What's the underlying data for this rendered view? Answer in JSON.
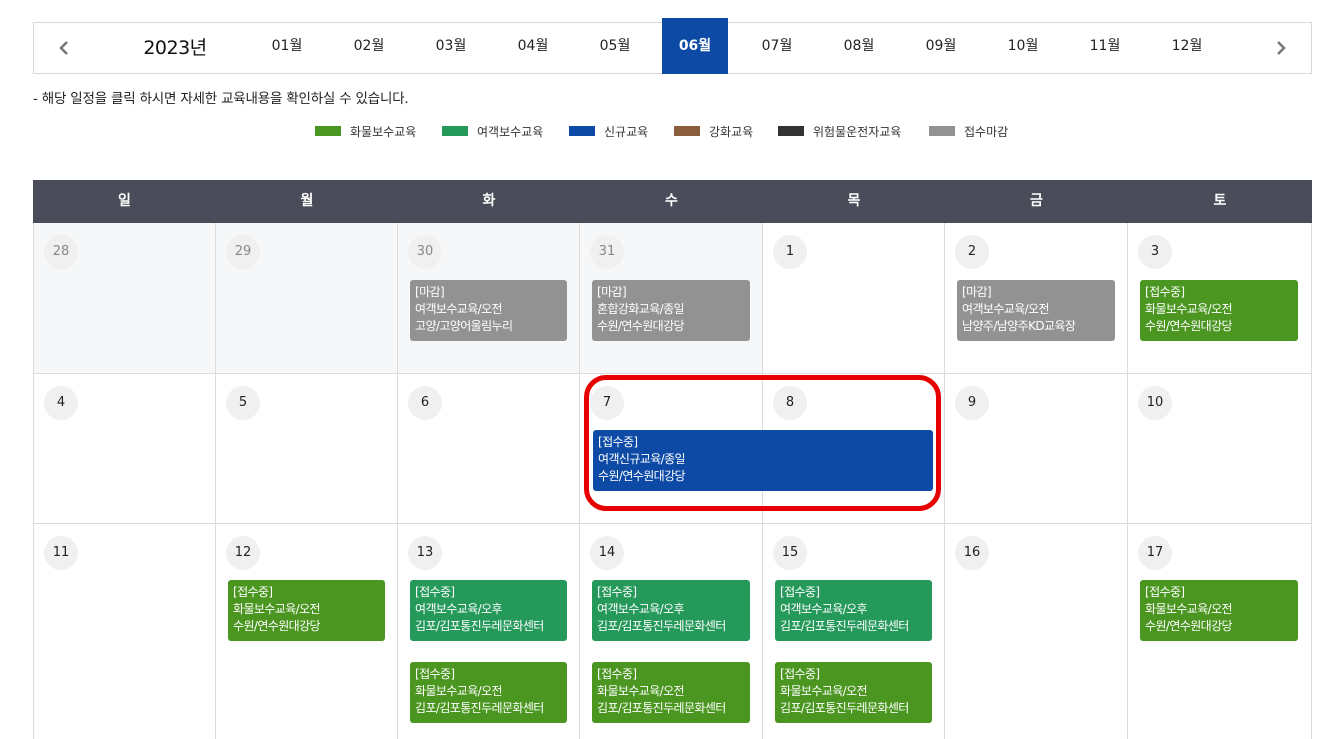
{
  "nav": {
    "year": "2023년",
    "months": [
      "01월",
      "02월",
      "03월",
      "04월",
      "05월",
      "06월",
      "07월",
      "08월",
      "09월",
      "10월",
      "11월",
      "12월"
    ],
    "active_month_index": 5
  },
  "notice": "- 해당 일정을 클릭 하시면 자세한 교육내용을 확인하실 수 있습니다.",
  "legend": [
    {
      "label": "화물보수교육",
      "color": "#4a9620"
    },
    {
      "label": "여객보수교육",
      "color": "#25995a"
    },
    {
      "label": "신규교육",
      "color": "#0d4aa6"
    },
    {
      "label": "강화교육",
      "color": "#8a5e3c"
    },
    {
      "label": "위험물운전자교육",
      "color": "#333333"
    },
    {
      "label": "접수마감",
      "color": "#929292"
    }
  ],
  "weekdays": [
    "일",
    "월",
    "화",
    "수",
    "목",
    "금",
    "토"
  ],
  "weeks": [
    {
      "days": [
        "28",
        "29",
        "30",
        "31",
        "1",
        "2",
        "3"
      ]
    },
    {
      "days": [
        "4",
        "5",
        "6",
        "7",
        "8",
        "9",
        "10"
      ]
    },
    {
      "days": [
        "11",
        "12",
        "13",
        "14",
        "15",
        "16",
        "17"
      ]
    }
  ],
  "events": {
    "w0_tue": {
      "status": "[마감]",
      "title": "여객보수교육/오전",
      "place": "고양/고양어울림누리"
    },
    "w0_wed": {
      "status": "[마감]",
      "title": "혼합강화교육/종일",
      "place": "수원/연수원대강당"
    },
    "w0_fri": {
      "status": "[마감]",
      "title": "여객보수교육/오전",
      "place": "남양주/남양주KD교육장"
    },
    "w0_sat": {
      "status": "[접수중]",
      "title": "화물보수교육/오전",
      "place": "수원/연수원대강당"
    },
    "w1_wed_thu": {
      "status": "[접수중]",
      "title": "여객신규교육/종일",
      "place": "수원/연수원대강당"
    },
    "w2_mon": {
      "status": "[접수중]",
      "title": "화물보수교육/오전",
      "place": "수원/연수원대강당"
    },
    "w2_tue_a": {
      "status": "[접수중]",
      "title": "여객보수교육/오후",
      "place": "김포/김포통진두레문화센터"
    },
    "w2_tue_b": {
      "status": "[접수중]",
      "title": "화물보수교육/오전",
      "place": "김포/김포통진두레문화센터"
    },
    "w2_wed_a": {
      "status": "[접수중]",
      "title": "여객보수교육/오후",
      "place": "김포/김포통진두레문화센터"
    },
    "w2_wed_b": {
      "status": "[접수중]",
      "title": "화물보수교육/오전",
      "place": "김포/김포통진두레문화센터"
    },
    "w2_thu_a": {
      "status": "[접수중]",
      "title": "여객보수교육/오후",
      "place": "김포/김포통진두레문화센터"
    },
    "w2_thu_b": {
      "status": "[접수중]",
      "title": "화물보수교육/오전",
      "place": "김포/김포통진두레문화센터"
    },
    "w2_sat": {
      "status": "[접수중]",
      "title": "화물보수교육/오전",
      "place": "수원/연수원대강당"
    }
  }
}
